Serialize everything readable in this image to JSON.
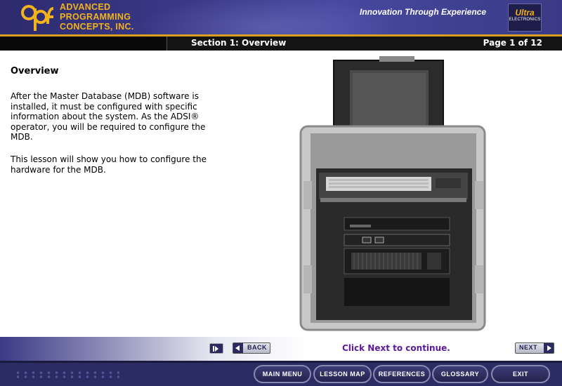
{
  "header": {
    "company": [
      "ADVANCED",
      "PROGRAMMING",
      "CONCEPTS, INC."
    ],
    "tagline": "Innovation Through Experience",
    "partner_logo": {
      "line1": "Ultra",
      "line2": "ELECTRONICS"
    },
    "logo_icon": "apc-logo-icon",
    "colors": {
      "header_bg": "#3b3a88",
      "gold": "#f2b31d"
    }
  },
  "section_bar": {
    "title": "Section 1: Overview",
    "page": "Page 1 of 12"
  },
  "content": {
    "heading": "Overview",
    "paragraphs": [
      "After the Master Database (MDB) software is installed, it must be configured with specific information about the system. As the ADSI® operator, you will be required to configure the MDB.",
      "This lesson will show you how to configure the hardware for the MDB."
    ],
    "image": "rack-mounted-computer-case-image"
  },
  "nav": {
    "skip_icon": "skip-forward-icon",
    "back_label": "BACK",
    "next_label": "NEXT",
    "prompt": "Click Next to continue.",
    "prompt_color": "#5a1a9a"
  },
  "footer": {
    "buttons": [
      "MAIN MENU",
      "LESSON MAP",
      "REFERENCES",
      "GLOSSARY",
      "EXIT"
    ]
  }
}
